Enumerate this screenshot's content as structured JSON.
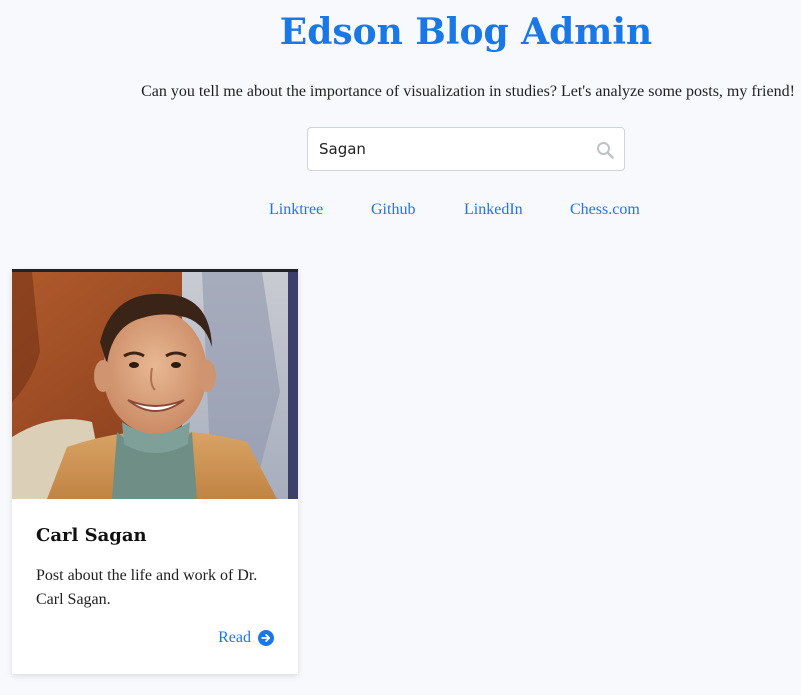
{
  "header": {
    "title": "Edson Blog Admin",
    "subtitle": "Can you tell me about the importance of visualization in studies? Let's analyze some posts, my friend!"
  },
  "search": {
    "value": "Sagan",
    "icon": "search-icon"
  },
  "nav": {
    "links": [
      {
        "label": "Linktree"
      },
      {
        "label": "Github"
      },
      {
        "label": "LinkedIn"
      },
      {
        "label": "Chess.com"
      }
    ]
  },
  "posts": [
    {
      "title": "Carl Sagan",
      "description": "Post about the life and work of Dr. Carl Sagan.",
      "read_label": "Read",
      "read_icon": "arrow-right-circle-icon"
    }
  ],
  "colors": {
    "accent": "#1a78e6",
    "background": "#f8f9fd"
  }
}
